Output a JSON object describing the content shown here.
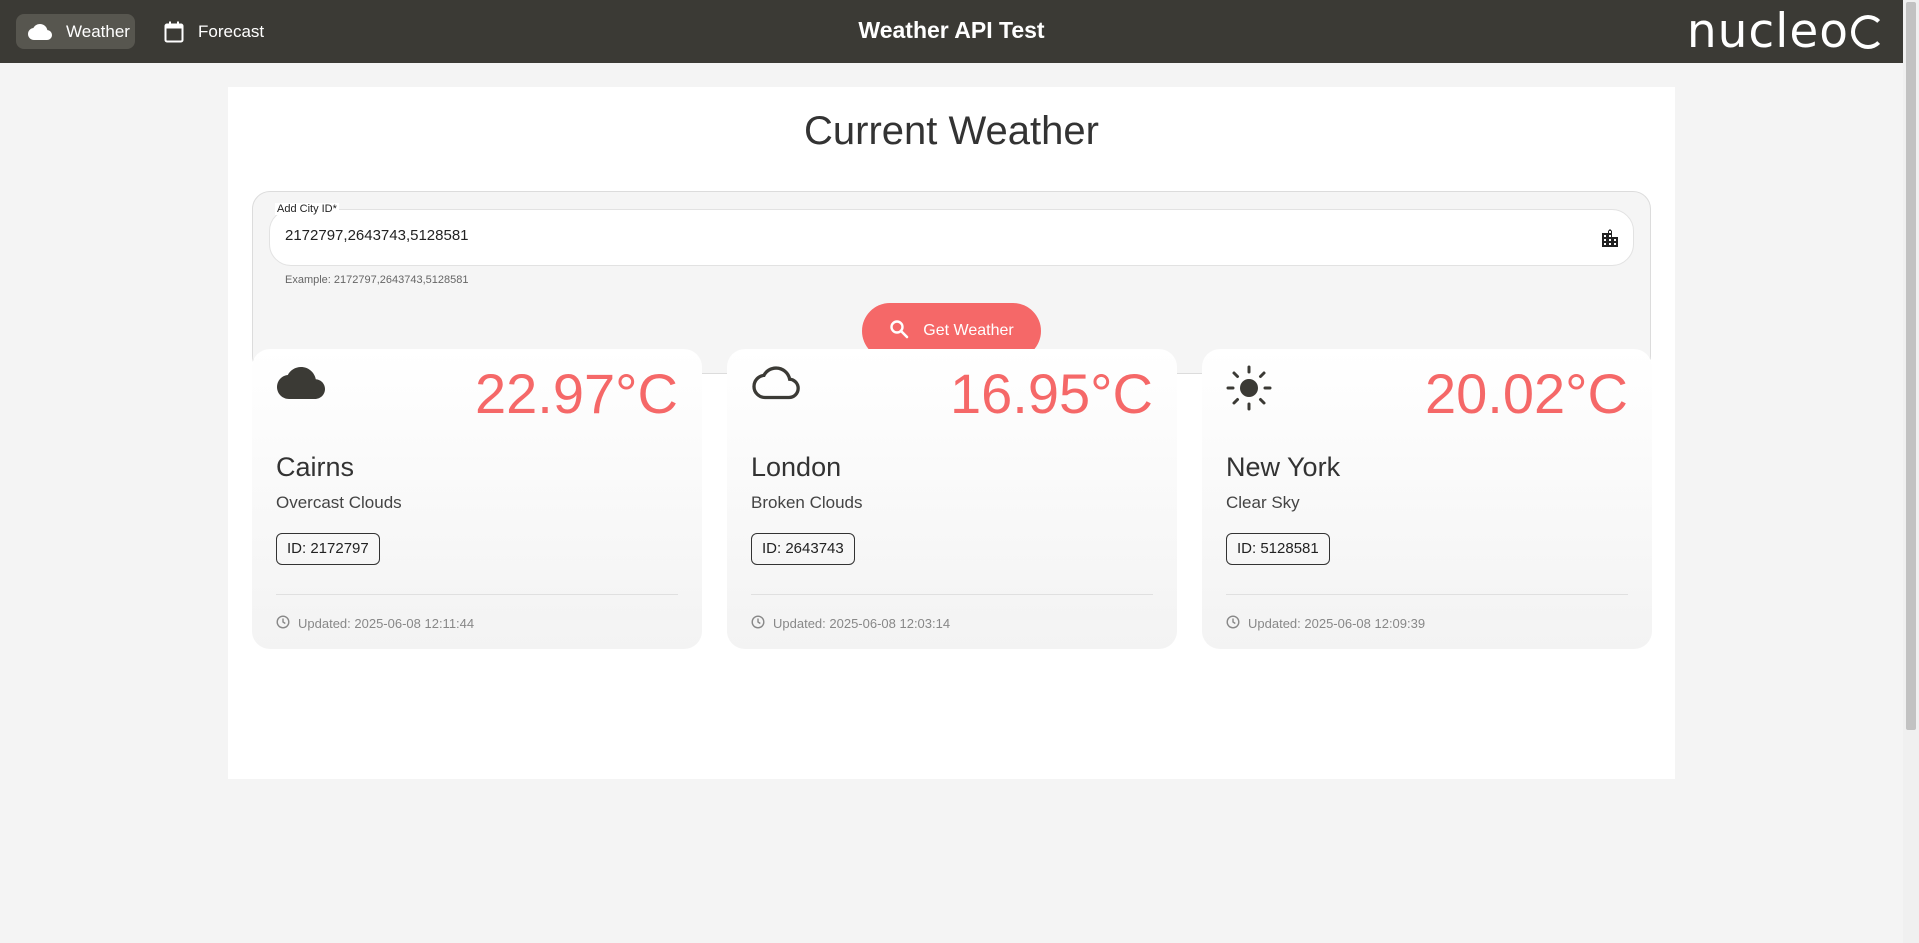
{
  "nav": {
    "weather_label": "Weather",
    "forecast_label": "Forecast"
  },
  "app_title": "Weather API Test",
  "logo_text": "nucleo",
  "main": {
    "heading": "Current Weather",
    "city_field": {
      "label": "Add City ID*",
      "value": "2172797,2643743,5128581",
      "hint": "Example: 2172797,2643743,5128581"
    },
    "get_button_label": "Get Weather"
  },
  "cards": [
    {
      "icon": "cloud-filled-icon",
      "temp": "22.97°C",
      "city": "Cairns",
      "desc": "Overcast Clouds",
      "id": "ID: 2172797",
      "updated": "Updated: 2025-06-08 12:11:44"
    },
    {
      "icon": "cloud-outline-icon",
      "temp": "16.95°C",
      "city": "London",
      "desc": "Broken Clouds",
      "id": "ID: 2643743",
      "updated": "Updated: 2025-06-08 12:03:14"
    },
    {
      "icon": "sun-icon",
      "temp": "20.02°C",
      "city": "New York",
      "desc": "Clear Sky",
      "id": "ID: 5128581",
      "updated": "Updated: 2025-06-08 12:09:39"
    }
  ],
  "colors": {
    "topbar": "#3b3a35",
    "accent": "#f56868"
  }
}
